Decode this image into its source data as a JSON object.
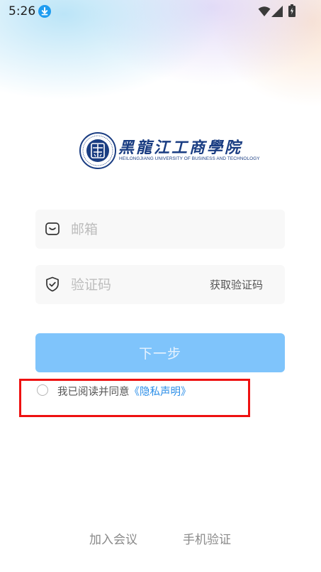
{
  "status_bar": {
    "time": "5:26",
    "icons": [
      "download-icon",
      "wifi-icon",
      "signal-icon",
      "battery-icon"
    ]
  },
  "logo": {
    "name": "黑龍江工商學院",
    "english": "HEILONGJIANG UNIVERSITY OF BUSINESS AND TECHNOLOGY",
    "color": "#1a3d82"
  },
  "form": {
    "email_placeholder": "邮箱",
    "email_value": "",
    "code_placeholder": "验证码",
    "code_value": "",
    "get_code_label": "获取验证码",
    "next_label": "下一步"
  },
  "agreement": {
    "checked": false,
    "text": "我已阅读并同意",
    "link": "《隐私声明》"
  },
  "bottom": {
    "join_meeting": "加入会议",
    "phone_verify": "手机验证"
  },
  "colors": {
    "accent": "#2b8ee8",
    "button_disabled": "#7fc4fb",
    "highlight": "#ee1111"
  }
}
